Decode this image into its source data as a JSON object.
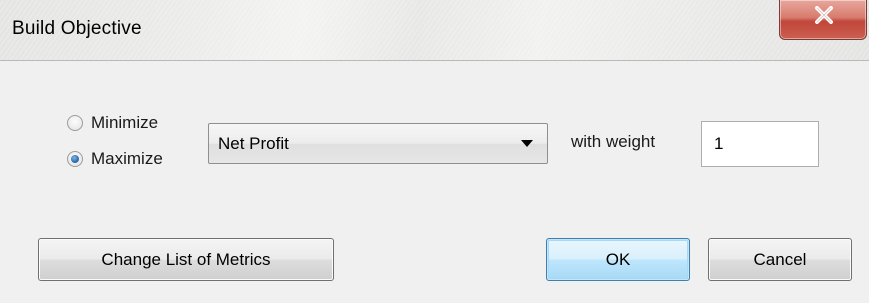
{
  "window": {
    "title": "Build Objective",
    "close_icon": "close-icon"
  },
  "objective": {
    "options": [
      {
        "label": "Minimize",
        "checked": false
      },
      {
        "label": "Maximize",
        "checked": true
      }
    ],
    "metric": {
      "selected": "Net Profit"
    },
    "weight_label": "with weight",
    "weight_value": "1"
  },
  "buttons": {
    "change_metrics": "Change List of Metrics",
    "ok": "OK",
    "cancel": "Cancel"
  },
  "colors": {
    "close_button": "#c0463a",
    "radio_selected": "#2a6fb0",
    "default_button_border": "#3c7fb1"
  }
}
